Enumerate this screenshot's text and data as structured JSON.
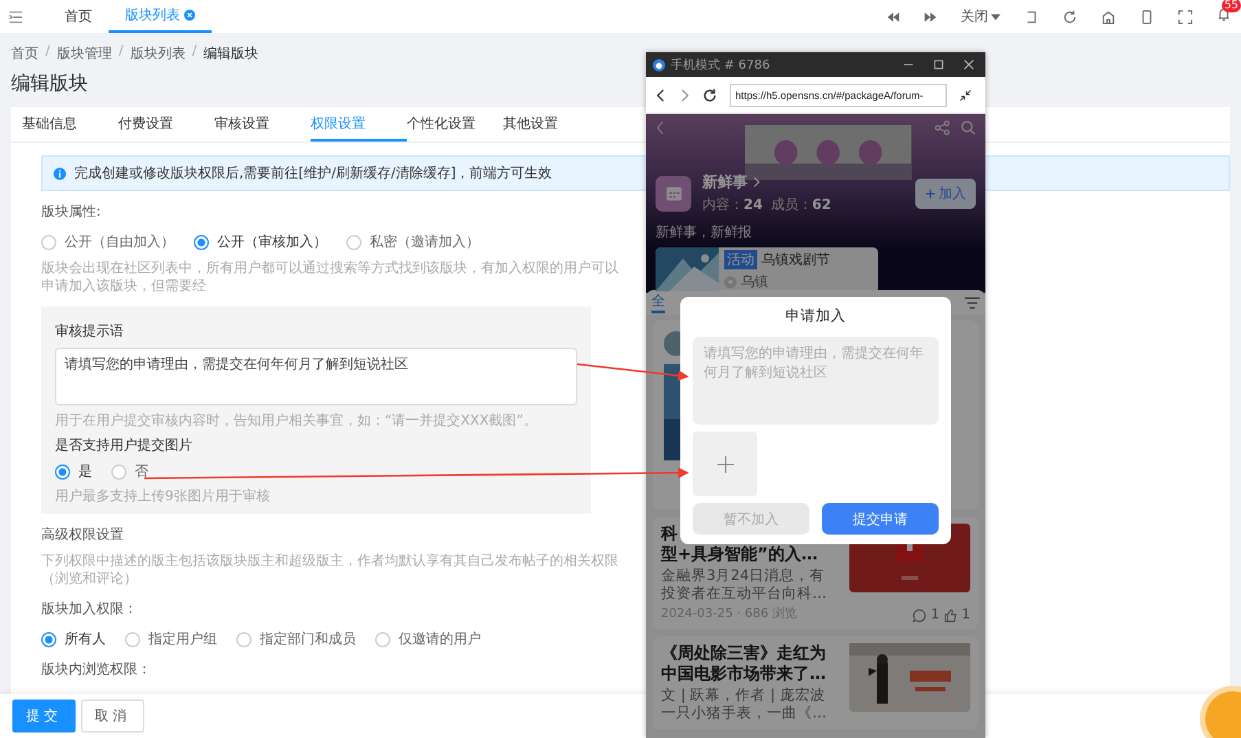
{
  "topbar": {
    "tabs": [
      {
        "label": "首页",
        "selected": false,
        "closable": false
      },
      {
        "label": "版块列表",
        "selected": true,
        "closable": true
      }
    ],
    "close_menu": "关闭",
    "notification_count": "55"
  },
  "breadcrumb": [
    "首页",
    "版块管理",
    "版块列表",
    "编辑版块"
  ],
  "breadcrumb_separator": "/",
  "page_title": "编辑版块",
  "tabs": [
    {
      "label": "基础信息",
      "selected": false
    },
    {
      "label": "付费设置",
      "selected": false
    },
    {
      "label": "审核设置",
      "selected": false
    },
    {
      "label": "权限设置",
      "selected": true
    },
    {
      "label": "个性化设置",
      "selected": false
    },
    {
      "label": "其他设置",
      "selected": false
    }
  ],
  "alert": "完成创建或修改版块权限后,需要前往[维护/刷新缓存/清除缓存]，前端方可生效",
  "attribute": {
    "label": "版块属性:",
    "options": [
      {
        "label": "公开（自由加入）",
        "selected": false
      },
      {
        "label": "公开（审核加入）",
        "selected": true
      },
      {
        "label": "私密（邀请加入）",
        "selected": false
      }
    ],
    "description": "版块会出现在社区列表中，所有用户都可以通过搜索等方式找到该版块，有加入权限的用户可以申请加入该版块，但需要经"
  },
  "review": {
    "prompt_label": "审核提示语",
    "prompt_value": "请填写您的申请理由，需提交在何年何月了解到短说社区",
    "prompt_hint": "用于在用户提交审核内容时，告知用户相关事宜，如：“请一并提交XXX截图”。",
    "image_label": "是否支持用户提交图片",
    "image_options": [
      {
        "label": "是",
        "selected": true
      },
      {
        "label": "否",
        "selected": false
      }
    ],
    "image_hint": "用户最多支持上传9张图片用于审核"
  },
  "advanced": {
    "title": "高级权限设置",
    "description": "下列权限中描述的版主包括该版块版主和超级版主，作者均默认享有其自己发布帖子的相关权限（浏览和评论）"
  },
  "join": {
    "label": "版块加入权限：",
    "options": [
      {
        "label": "所有人",
        "selected": true
      },
      {
        "label": "指定用户组",
        "selected": false
      },
      {
        "label": "指定部门和成员",
        "selected": false
      },
      {
        "label": "仅邀请的用户",
        "selected": false
      }
    ]
  },
  "browse_label": "版块内浏览权限：",
  "footer": {
    "submit": "提交",
    "cancel": "取消"
  },
  "phone": {
    "title": "手机模式 # 6786",
    "url": "https://h5.opensns.cn/#/packageA/forum-",
    "forum": {
      "name": "新鲜事",
      "stats": [
        {
          "label": "内容：",
          "value": "24"
        },
        {
          "label": "成员：",
          "value": "62"
        }
      ],
      "join": "加入",
      "slogan": "新鲜事，新鲜报",
      "event": {
        "tag": "活动",
        "title": "乌镇戏剧节",
        "place": "乌镇"
      }
    },
    "feed_tab": "全",
    "articles": [
      {
        "title_lines": [
          "科",
          "型+具身智能”的入…"
        ],
        "summary": "金融界3月24日消息，有投资者在互动平台向科…",
        "meta": "2024-03-25 · 686 浏览",
        "comments": "1",
        "likes": "1"
      },
      {
        "title_lines": [
          "《周处除三害》走红为",
          "中国电影市场带来了…"
        ],
        "summary": "文 | 跃幕，作者 | 庞宏波一只小猪手表，一曲《…"
      }
    ],
    "dialog": {
      "title": "申请加入",
      "placeholder": "请填写您的申请理由，需提交在何年何月了解到短说社区",
      "cancel": "暂不加入",
      "submit": "提交申请"
    },
    "dimmed": true
  }
}
